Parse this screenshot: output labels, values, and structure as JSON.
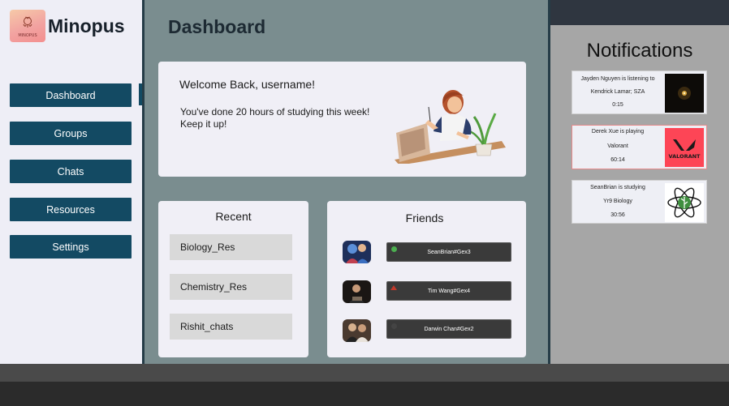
{
  "app": {
    "brand": "Minopus",
    "logo_text": "MINOPUS"
  },
  "sidebar": {
    "items": [
      {
        "label": "Dashboard"
      },
      {
        "label": "Groups"
      },
      {
        "label": "Chats"
      },
      {
        "label": "Resources"
      },
      {
        "label": "Settings"
      }
    ],
    "active": "Dashboard"
  },
  "main": {
    "title": "Dashboard",
    "welcome": {
      "title": "Welcome Back, username!",
      "line1": "You've done 20 hours of studying this week!",
      "line2": "Keep it up!"
    },
    "recent": {
      "title": "Recent",
      "items": [
        "Biology_Res",
        "Chemistry_Res",
        "Rishit_chats"
      ]
    },
    "friends": {
      "title": "Friends",
      "items": [
        {
          "name": "SeanBrian#Gex3",
          "status": "online",
          "status_color": "#4caf50"
        },
        {
          "name": "Tim Wang#Gex4",
          "status": "away",
          "status_color": "#c0392b"
        },
        {
          "name": "Darwin Chan#Gex2",
          "status": "offline",
          "status_color": "#444444"
        }
      ]
    }
  },
  "notifications": {
    "title": "Notifications",
    "items": [
      {
        "line1": "Jayden Nguyen is listening to",
        "line2": "Kendrick Lamar; SZA",
        "time": "0:15",
        "icon": "album-art-icon"
      },
      {
        "line1": "Derek Xue is playing",
        "line2": "Valorant",
        "time": "60:14",
        "icon": "valorant-logo-icon",
        "logo_text": "VALORANT"
      },
      {
        "line1": "SeanBrian is studying",
        "line2": "Yr9 Biology",
        "time": "30:56",
        "icon": "biology-atom-icon"
      }
    ]
  },
  "colors": {
    "nav": "#134a63",
    "main_bg": "#7a8d8f",
    "card_bg": "#f0eff6",
    "notif_panel": "#a6a6a6",
    "valorant_red": "#fd4556"
  }
}
